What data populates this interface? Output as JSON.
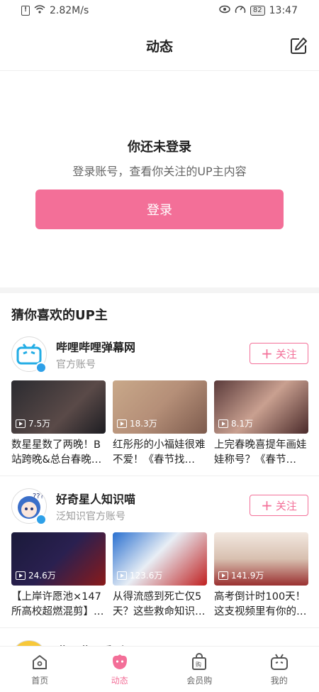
{
  "status": {
    "speed": "2.82M/s",
    "battery": "82",
    "time": "13:47"
  },
  "header": {
    "title": "动态"
  },
  "login": {
    "title": "你还未登录",
    "subtitle": "登录账号，查看你关注的UP主内容",
    "button": "登录"
  },
  "recommend": {
    "title": "猜你喜欢的UP主",
    "follow_label": "关注",
    "ups": [
      {
        "name": "哔哩哔哩弹幕网",
        "sub": "官方账号",
        "videos": [
          {
            "views": "7.5万",
            "caption": "数星星数了两晚！B站跨晚&总台春晚…"
          },
          {
            "views": "18.3万",
            "caption": "红彤彤的小福娃很难不爱！《春节找…"
          },
          {
            "views": "8.1万",
            "caption": "上完春晚喜提年画娃娃称号？《春节…"
          }
        ]
      },
      {
        "name": "好奇星人知识喵",
        "sub": "泛知识官方账号",
        "videos": [
          {
            "views": "24.6万",
            "caption": "【上岸许愿池×147所高校超燃混剪】…"
          },
          {
            "views": "123.6万",
            "caption": "从得流感到死亡仅5天？这些救命知识…"
          },
          {
            "views": "141.9万",
            "caption": "高考倒计时100天！这支视频里有你的…"
          }
        ]
      },
      {
        "name": "哔哩哔哩番剧"
      }
    ]
  },
  "tabs": [
    {
      "label": "首页",
      "icon": "home-icon"
    },
    {
      "label": "动态",
      "icon": "dynamic-icon"
    },
    {
      "label": "会员购",
      "icon": "shop-icon"
    },
    {
      "label": "我的",
      "icon": "tv-icon"
    }
  ],
  "colors": {
    "accent": "#f36f98",
    "badge": "#2ea0e8"
  }
}
